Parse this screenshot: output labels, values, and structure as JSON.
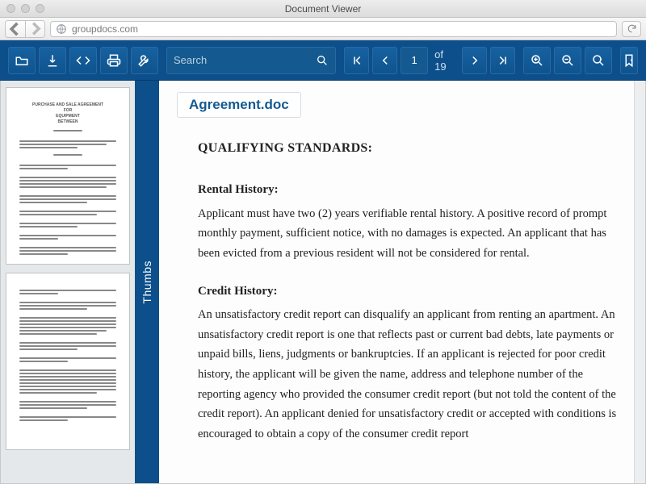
{
  "window": {
    "title": "Document Viewer",
    "url": "groupdocs.com"
  },
  "toolbar": {
    "search_placeholder": "Search",
    "page_current": "1",
    "page_of_label": "of 19"
  },
  "sidebar": {
    "tab_label": "Thumbs",
    "thumbs": [
      {
        "title": "PURCHASE AND SALE AGREEMENT\nFOR\nEQUIPMENT\nBETWEEN"
      },
      {
        "title": ""
      }
    ]
  },
  "document": {
    "filename": "Agreement.doc",
    "heading": "QUALIFYING STANDARDS:",
    "sections": [
      {
        "title": "Rental History:",
        "body": "Applicant must have two (2) years verifiable rental history. A positive record of prompt monthly payment, sufficient notice, with no damages is expected. An applicant that has been evicted from a previous resident will not be considered for rental."
      },
      {
        "title": "Credit History:",
        "body": "An unsatisfactory credit report can disqualify an applicant from renting an apartment. An unsatisfactory credit report is one that reflects past or current bad debts, late payments or unpaid bills, liens, judgments or bankruptcies. If an applicant is rejected for poor credit history, the applicant will be given the name, address and telephone number of the reporting agency who provided the consumer credit report (but not told the content of the credit report). An applicant denied for unsatisfactory credit or accepted with conditions is encouraged to obtain a copy of the consumer credit report"
      }
    ]
  }
}
